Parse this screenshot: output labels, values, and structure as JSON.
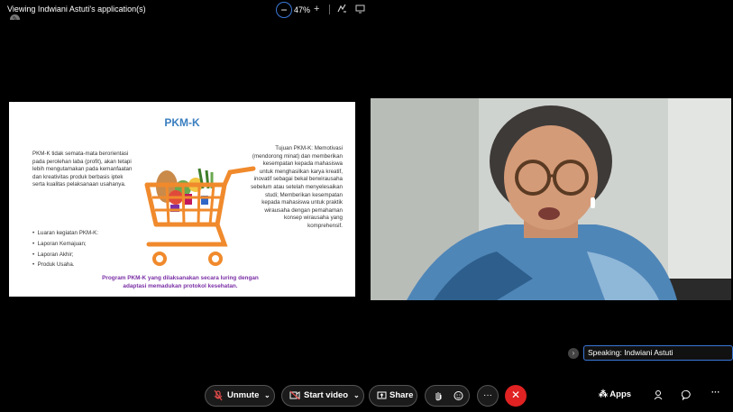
{
  "topbar": {
    "title": "Viewing Indwiani Astuti's application(s)",
    "zoom_level": "47%",
    "zoom_minus": "−",
    "zoom_plus": "+"
  },
  "slide": {
    "title": "PKM-K",
    "left_text": "PKM-K tidak semata-mata berorientasi pada perolehan laba (profit), akan tetapi lebih mengutamakan pada kemanfaatan dan kreativitas produk berbasis iptek serta kualitas pelaksanaan usahanya.",
    "right_text": "Tujuan PKM-K: Memotivasi (mendorong minat) dan memberikan kesempatan kepada mahasiswa untuk menghasilkan karya kreatif, inovatif sebagai bekal berwirausaha sebelum atau setelah menyelesaikan studi; Memberikan kesempatan kepada mahasiswa untuk praktik wirausaha dengan pemahaman konsep wirausaha yang komprehensif.",
    "bullets": [
      "Luaran kegiatan PKM-K:",
      "Laporan Kemajuan;",
      "Laporan Akhir;",
      "Produk Usaha."
    ],
    "bottom_text": "Program PKM-K yang dilaksanakan secara luring dengan adaptasi memadukan protokol kesehatan."
  },
  "speaking": {
    "label": "Speaking:",
    "name": "Indwiani Astuti"
  },
  "controls": {
    "unmute": "Unmute",
    "start_video": "Start video",
    "share": "Share",
    "more": "···",
    "apps": "Apps",
    "overflow": "···"
  },
  "colors": {
    "accent_blue": "#3a78d8",
    "end_call_red": "#e02222",
    "slide_title_blue": "#3b7fc0",
    "slide_bottom_purple": "#7a2fa5",
    "cart_orange": "#f08a2c"
  }
}
